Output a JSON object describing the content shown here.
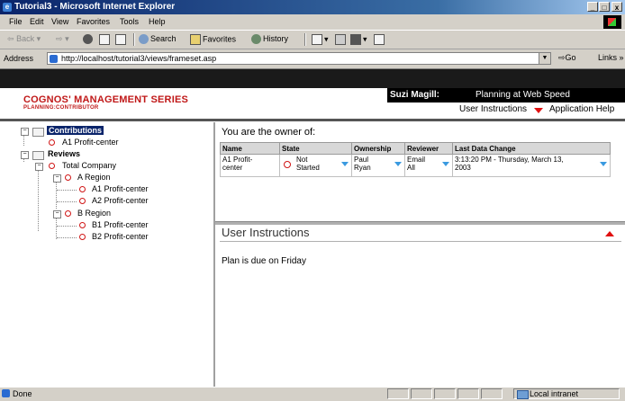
{
  "window": {
    "title": "Tutorial3 - Microsoft Internet Explorer",
    "controls": [
      "_",
      "□",
      "x"
    ]
  },
  "menu": [
    "File",
    "Edit",
    "View",
    "Favorites",
    "Tools",
    "Help"
  ],
  "toolbar": {
    "back": "Back",
    "search": "Search",
    "favorites": "Favorites",
    "history": "History"
  },
  "address": {
    "label": "Address",
    "url": "http://localhost/tutorial3/views/frameset.asp",
    "go": "Go",
    "links": "Links »"
  },
  "header": {
    "brand": "COGNOS' MANAGEMENT SERIES",
    "brand_sub": "PLANNING:CONTRIBUTOR",
    "user": "Suzi Magill:",
    "tagline": "Planning at Web Speed",
    "user_instructions": "User Instructions",
    "app_help": "Application Help"
  },
  "tree": {
    "contributions": "Contributions",
    "contrib_item": "A1 Profit-center",
    "reviews": "Reviews",
    "total_company": "Total Company",
    "a_region": "A Region",
    "a1": "A1 Profit-center",
    "a2": "A2 Profit-center",
    "b_region": "B Region",
    "b1": "B1 Profit-center",
    "b2": "B2 Profit-center"
  },
  "owner": {
    "title": "You are the owner of:",
    "columns": [
      "Name",
      "State",
      "Ownership",
      "Reviewer",
      "Last Data Change"
    ],
    "row": {
      "name_l1": "A1 Profit-",
      "name_l2": "center",
      "state_l1": "Not",
      "state_l2": "Started",
      "ownership_l1": "Paul",
      "ownership_l2": "Ryan",
      "reviewer_l1": "Email",
      "reviewer_l2": "All",
      "change_l1": "3:13:20 PM - Thursday, March 13,",
      "change_l2": "2003"
    }
  },
  "instructions": {
    "title": "User Instructions",
    "body": "Plan is due on Friday"
  },
  "status": {
    "text": "Done",
    "zone": "Local intranet"
  },
  "colors": {
    "brand_red": "#c01818",
    "selection": "#0a246a",
    "dropdown_arrow": "#3a9ae0",
    "state_red": "#d01515"
  }
}
